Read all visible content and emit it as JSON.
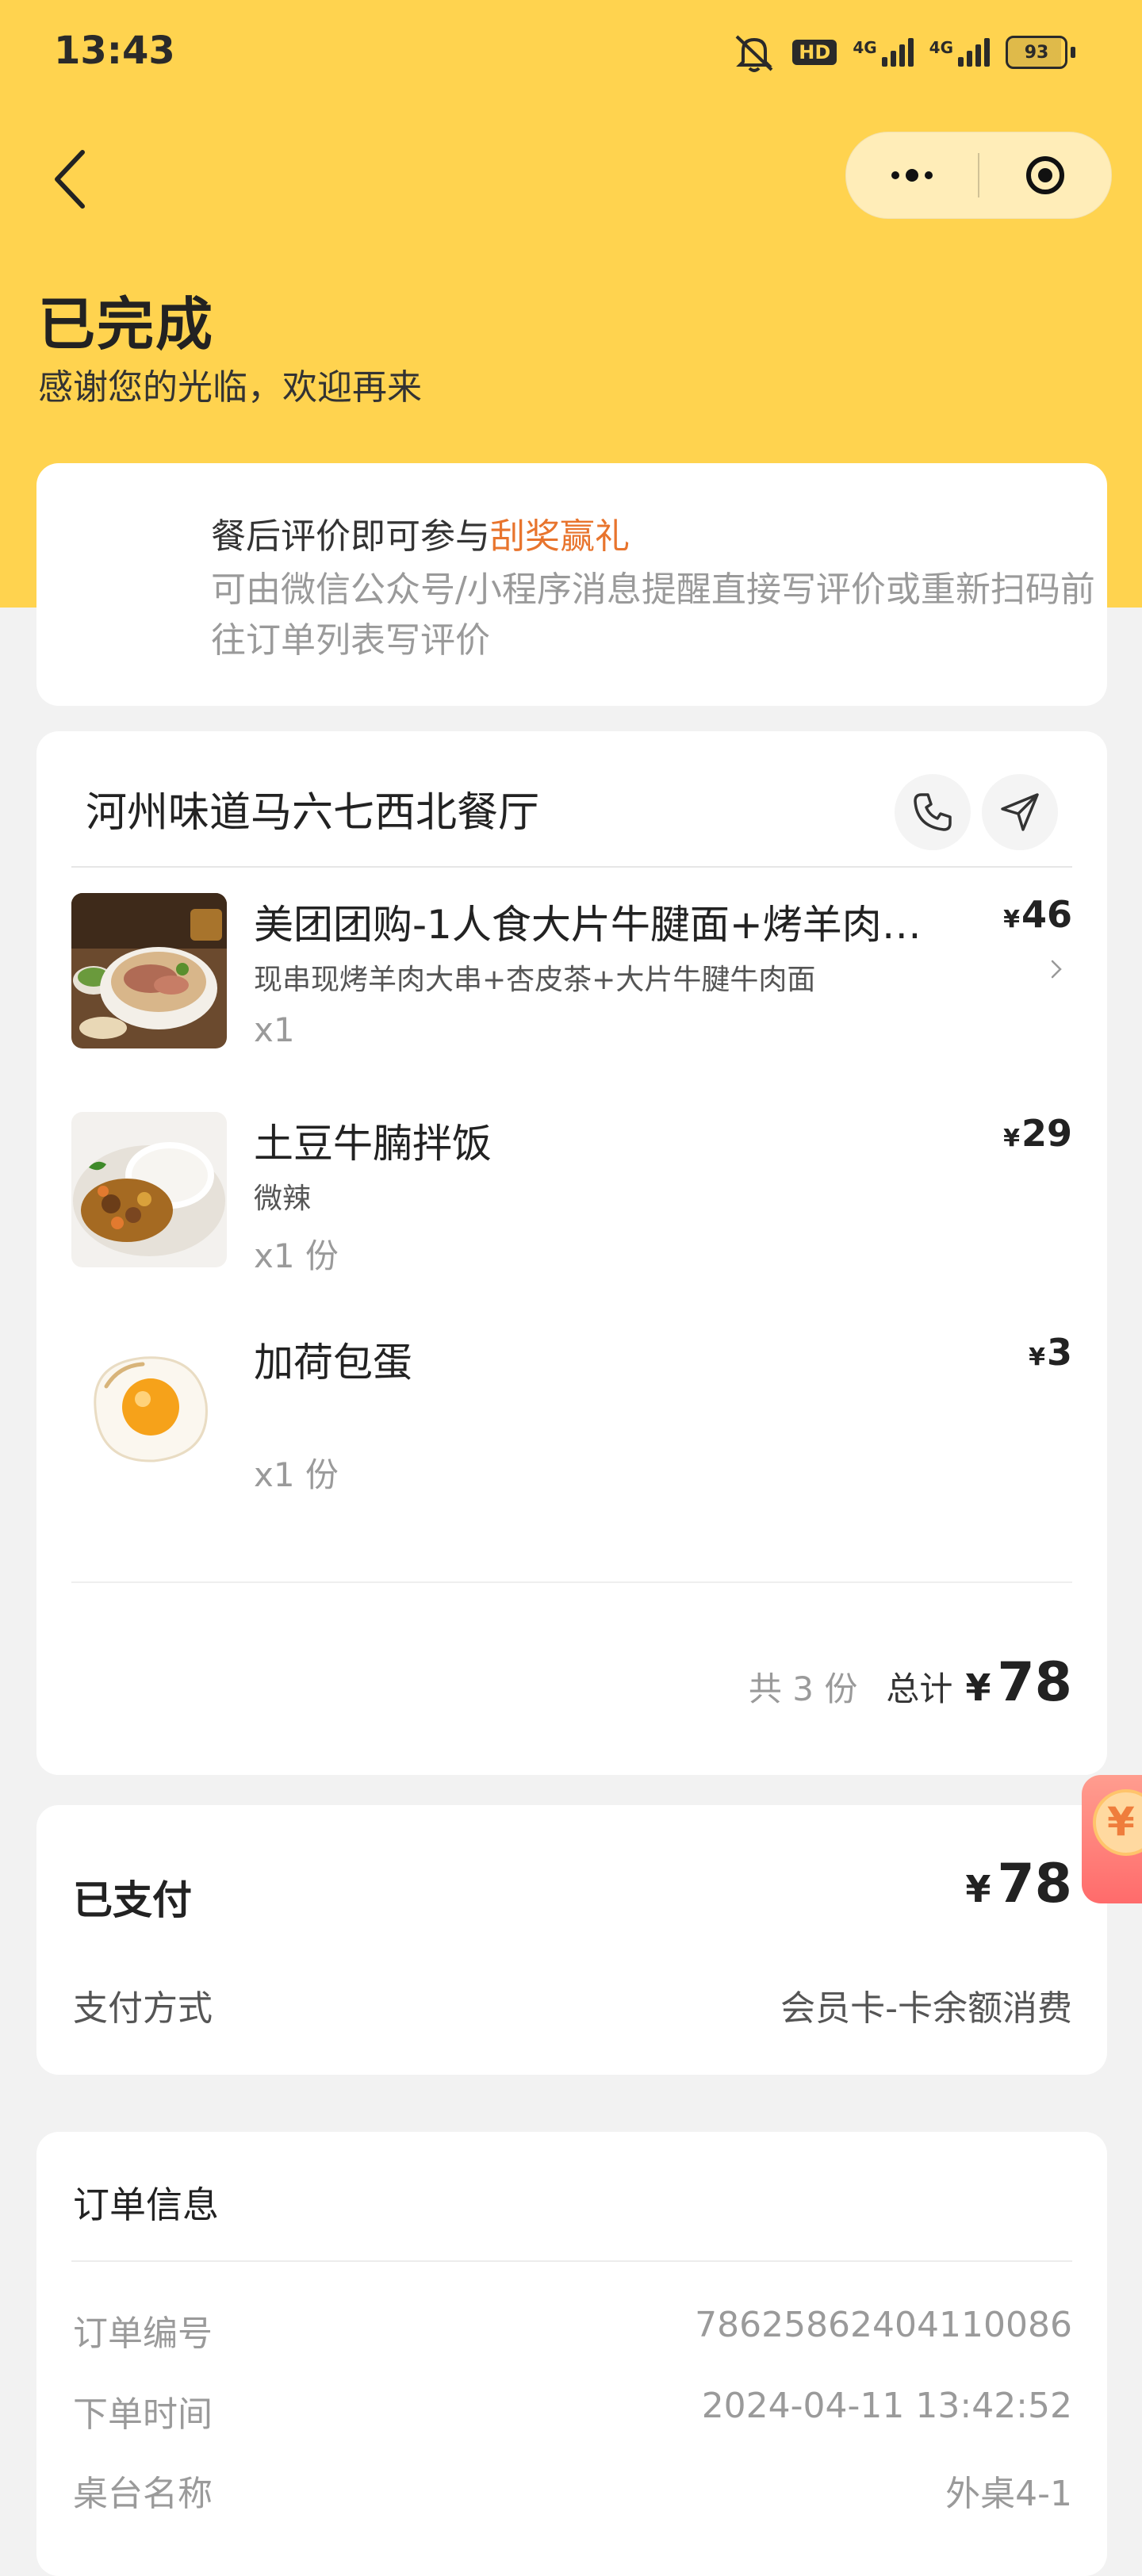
{
  "status_bar": {
    "time": "13:43",
    "hd_label": "HD",
    "signal_label_1": "4G",
    "signal_label_2": "4G",
    "battery": "93"
  },
  "header": {
    "title": "已完成",
    "subtitle": "感谢您的光临，欢迎再来"
  },
  "review": {
    "title_prefix": "餐后评价即可参与",
    "title_highlight": "刮奖赢礼",
    "description": "可由微信公众号/小程序消息提醒直接写评价或重新扫码前往订单列表写评价"
  },
  "order": {
    "shop_name": "河州味道马六七西北餐厅",
    "items": [
      {
        "name": "美团团购-1人食大片牛腱面+烤羊肉…",
        "spec": "现串现烤羊肉大串+杏皮茶+大片牛腱牛肉面",
        "qty": "x1",
        "currency": "¥",
        "price": "46",
        "image": "beef-noodle-set"
      },
      {
        "name": "土豆牛腩拌饭",
        "spec": "微辣",
        "qty": "x1 份",
        "currency": "¥",
        "price": "29",
        "image": "potato-beef-rice"
      },
      {
        "name": "加荷包蛋",
        "spec": "",
        "qty": "x1 份",
        "currency": "¥",
        "price": "3",
        "image": "fried-egg"
      }
    ],
    "total_count": "共 3 份",
    "total_label": "总计",
    "total_currency": "¥",
    "total_amount": "78"
  },
  "payment": {
    "title": "已支付",
    "currency": "¥",
    "amount": "78",
    "method_label": "支付方式",
    "method_value": "会员卡-卡余额消费"
  },
  "order_info": {
    "title": "订单信息",
    "rows": [
      {
        "label": "订单编号",
        "value": "78625862404110086"
      },
      {
        "label": "下单时间",
        "value": "2024-04-11 13:42:52"
      },
      {
        "label": "桌台名称",
        "value": "外桌4-1"
      }
    ]
  },
  "floating": {
    "envelope_symbol": "¥"
  },
  "colors": {
    "header_bg": "#ffd34f",
    "highlight": "#e8742d",
    "page_bg": "#f2f2f2"
  }
}
